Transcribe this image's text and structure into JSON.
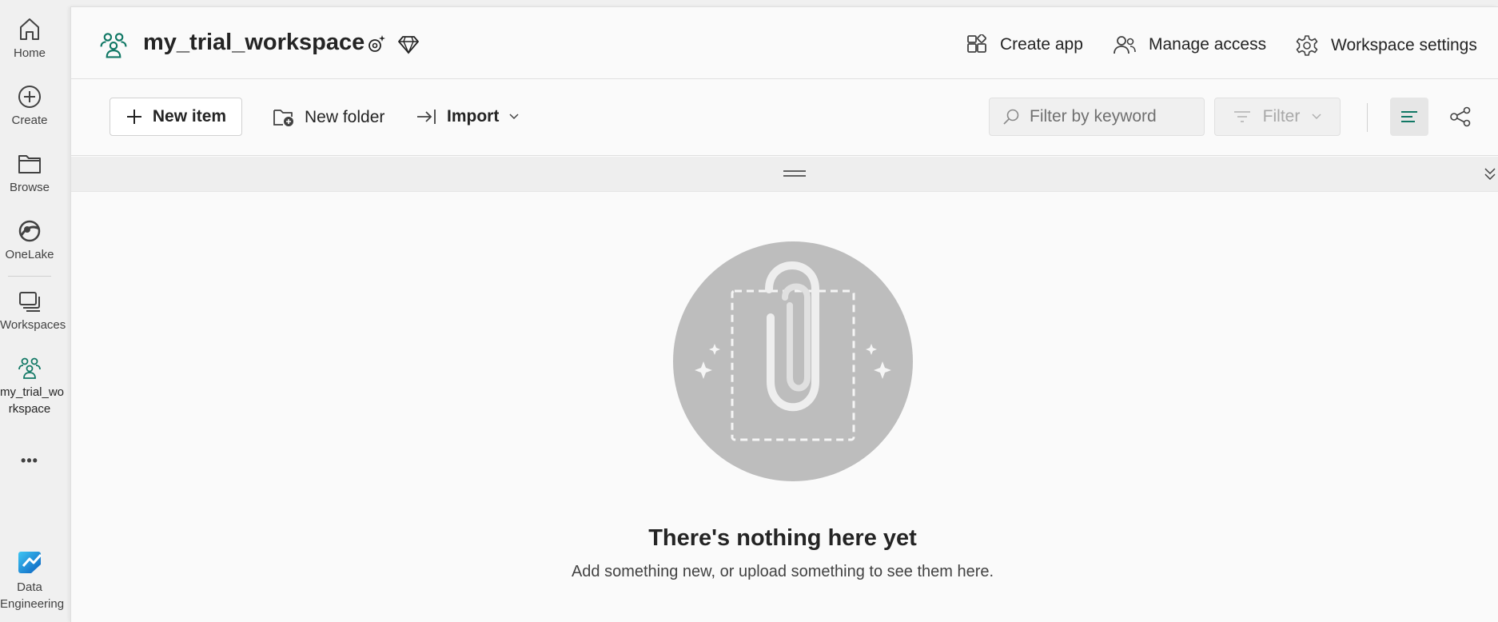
{
  "rail": {
    "home": "Home",
    "create": "Create",
    "browse": "Browse",
    "onelake": "OneLake",
    "workspaces": "Workspaces",
    "workspace_line1": "my_trial_wo",
    "workspace_line2": "rkspace",
    "more": "•••",
    "experience_line1": "Data",
    "experience_line2": "Engineering"
  },
  "header": {
    "title": "my_trial_workspace",
    "create_app": "Create app",
    "manage_access": "Manage access",
    "workspace_settings": "Workspace settings"
  },
  "toolbar": {
    "new_item": "New item",
    "new_folder": "New folder",
    "import": "Import",
    "search_placeholder": "Filter by keyword",
    "filter": "Filter"
  },
  "empty_state": {
    "title": "There's nothing here yet",
    "subtitle": "Add something new, or upload something to see them here."
  },
  "colors": {
    "accent": "#117865",
    "illustration_circle": "#bdbdbd"
  },
  "icons": [
    "home-icon",
    "create-icon",
    "browse-icon",
    "onelake-icon",
    "workspaces-icon",
    "workspace-people-icon",
    "more-icon",
    "data-engineering-icon",
    "sparkle-settings-icon",
    "premium-diamond-icon",
    "create-app-icon",
    "manage-access-icon",
    "settings-gear-icon",
    "plus-icon",
    "new-folder-icon",
    "import-icon",
    "chevron-down-icon",
    "search-icon",
    "filter-icon",
    "list-view-icon",
    "lineage-view-icon",
    "grip-icon",
    "collapse-chevron-icon",
    "paperclip-illustration"
  ]
}
